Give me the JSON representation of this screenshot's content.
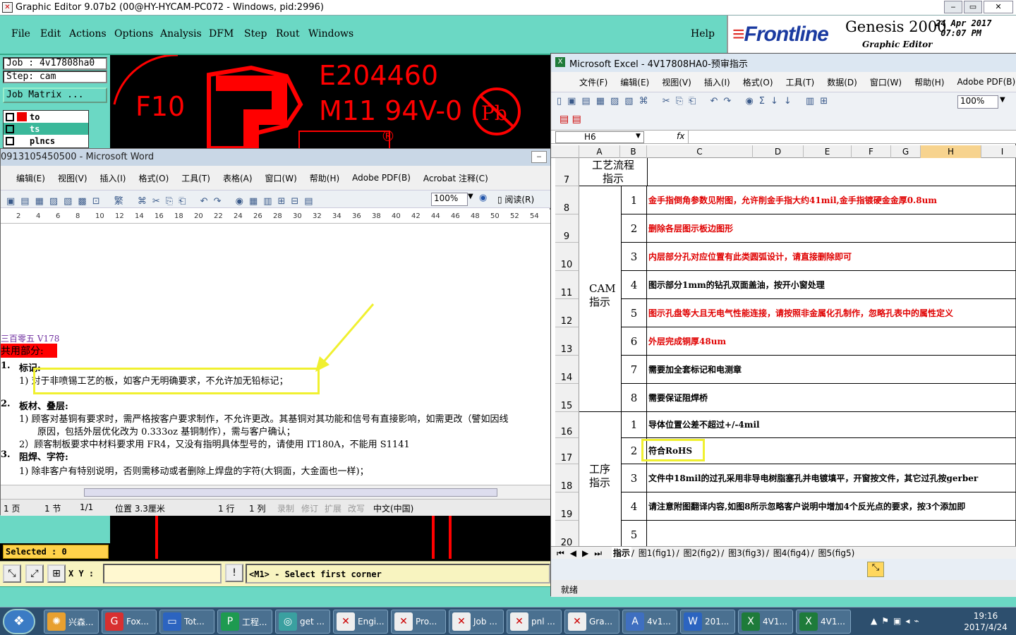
{
  "genesis": {
    "title": "Graphic Editor 9.07b2 (00@HY-HYCAM-PC072 - Windows, pid:2996)",
    "menu": [
      "File",
      "Edit",
      "Actions",
      "Options",
      "Analysis",
      "DFM",
      "Step",
      "Rout",
      "Windows"
    ],
    "help": "Help",
    "brand": {
      "logo": "Frontline",
      "product": "Genesis 2000",
      "date": "24 Apr 2017",
      "time": "07:07 PM",
      "subtitle": "Graphic Editor"
    },
    "job": "Job : 4v17808ha0",
    "step": "Step: cam",
    "job_matrix": "Job Matrix ...",
    "layers": [
      "to",
      "ts",
      "plncs"
    ],
    "canvas_text": {
      "f10": "F10",
      "ul": "E204460",
      "grade": "M11 94V-0",
      "pb": "Pb"
    },
    "selected": "Selected : 0",
    "xy_label": "X Y :",
    "xy_value": "",
    "status": "<M1> - Select first corner",
    "colors": {
      "teal": "#6bd8c4",
      "red": "#ff0000",
      "yellow": "#ffd24a"
    }
  },
  "word": {
    "title": "0913105450500 - Microsoft Word",
    "menu": [
      "编辑(E)",
      "视图(V)",
      "插入(I)",
      "格式(O)",
      "工具(T)",
      "表格(A)",
      "窗口(W)",
      "帮助(H)",
      "Adobe PDF(B)",
      "Acrobat 注释(C)"
    ],
    "zoom": "100%",
    "read_button": "阅读(R)",
    "ruler": [
      "2",
      "4",
      "6",
      "8",
      "10",
      "12",
      "14",
      "16",
      "18",
      "20",
      "22",
      "24",
      "26",
      "28",
      "30",
      "32",
      "34",
      "36",
      "38",
      "40",
      "42",
      "44",
      "46",
      "48",
      "50",
      "52",
      "54"
    ],
    "lines": {
      "header": "三百零五 V178",
      "common": "共用部分:",
      "s1": "1.",
      "s1_title": "标记:",
      "s1_1": "1)  对于非喷锡工艺的板，如客户无明确要求，不允许加无铅标记；",
      "s2": "2.",
      "s2_title": "板材、叠层:",
      "s2_1": "1)  顾客对基铜有要求时，需严格按客户要求制作，不允许更改。其基铜对其功能和信号有直接影响，如需更改（譬如因线",
      "s2_1b": "原因，包括外层优化改为 0.333oz 基铜制作），需与客户确认；",
      "s2_2": "2）顾客制板要求中材料要求用 FR4，又没有指明具体型号的，请使用 IT180A，不能用 S1141",
      "s3": "3.",
      "s3_title": "阻焊、字符:",
      "s3_1": "1)  除非客户有特别说明，否则需移动或者删除上焊盘的字符(大铜面，大金面也一样)；"
    },
    "status": {
      "page": "1 页",
      "section": "1 节",
      "pages": "1/1",
      "pos": "位置 3.3厘米",
      "line": "1 行",
      "col": "1 列",
      "rec": "录制",
      "rev": "修订",
      "ext": "扩展",
      "ovr": "改写",
      "lang": "中文(中国)"
    }
  },
  "excel": {
    "title": "Microsoft Excel - 4V17808HA0-预审指示",
    "menu": [
      "文件(F)",
      "编辑(E)",
      "视图(V)",
      "插入(I)",
      "格式(O)",
      "工具(T)",
      "数据(D)",
      "窗口(W)",
      "帮助(H)",
      "Adobe PDF(B)"
    ],
    "zoom": "100%",
    "namebox": "H6",
    "fx": "fx",
    "columns": [
      "A",
      "B",
      "C",
      "D",
      "E",
      "F",
      "G",
      "H",
      "I"
    ],
    "header_cell": "工艺流程指示",
    "group_cam": "CAM指示",
    "group_proc": "工序指示",
    "rows": [
      {
        "n": "7",
        "num": "",
        "text": "",
        "red": false
      },
      {
        "n": "8",
        "num": "1",
        "text": "金手指倒角参数见附图，允许削金手指大约41mil,金手指镀硬金金厚0.8um",
        "red": true
      },
      {
        "n": "9",
        "num": "2",
        "text": "删除各层图示板边图形",
        "red": true
      },
      {
        "n": "10",
        "num": "3",
        "text": "内层部分孔对应位置有此类圆弧设计，请直接删除即可",
        "red": true
      },
      {
        "n": "11",
        "num": "4",
        "text": "图示部分1mm的钻孔双面盖油，按开小窗处理",
        "red": false
      },
      {
        "n": "12",
        "num": "5",
        "text": "图示孔盘等大且无电气性能连接，请按照非金属化孔制作，忽略孔表中的属性定义",
        "red": true
      },
      {
        "n": "13",
        "num": "6",
        "text": "外层完成铜厚48um",
        "red": true
      },
      {
        "n": "14",
        "num": "7",
        "text": "需要加全套标记和电测章",
        "red": false
      },
      {
        "n": "15",
        "num": "8",
        "text": "需要保证阻焊桥",
        "red": false
      },
      {
        "n": "16",
        "num": "1",
        "text": "导体位置公差不超过+/-4mil",
        "red": false
      },
      {
        "n": "17",
        "num": "2",
        "text": "符合RoHS",
        "red": false
      },
      {
        "n": "18",
        "num": "3",
        "text": "文件中18mil的过孔采用非导电树脂塞孔并电镀填平，开窗按文件，其它过孔按gerber",
        "red": false
      },
      {
        "n": "19",
        "num": "4",
        "text": "请注意附图翻译内容,如图8所示忽略客户说明中增加4个反光点的要求，按3个添加即",
        "red": false
      },
      {
        "n": "20",
        "num": "5",
        "text": "",
        "red": false
      }
    ],
    "sheets": [
      "指示",
      "图1(fig1)",
      "图2(fig2)",
      "图3(fig3)",
      "图4(fig4)",
      "图5(fig5)"
    ],
    "status": "就绪"
  },
  "taskbar": {
    "items": [
      "兴森...",
      "Fox...",
      "Tot...",
      "工程...",
      "get ...",
      "Engi...",
      "Pro...",
      "Job ...",
      "pnl ...",
      "Gra...",
      "4v1...",
      "201...",
      "4V1...",
      "4V1..."
    ],
    "time": "19:16",
    "date": "2017/4/24"
  }
}
